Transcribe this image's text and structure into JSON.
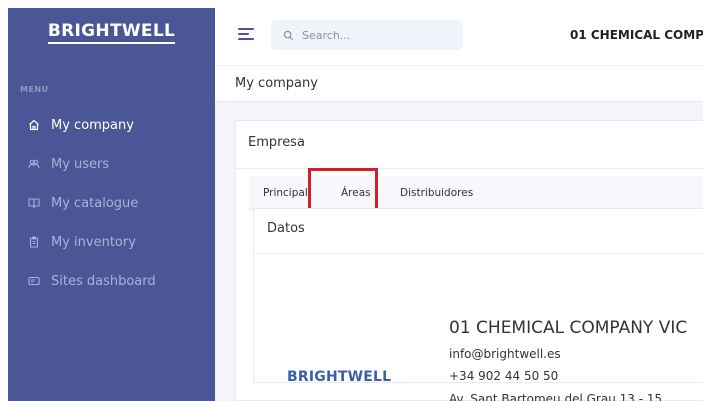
{
  "brand": {
    "logo_text": "BRIGHTWELL"
  },
  "sidebar": {
    "menu_title": "MENU",
    "items": [
      {
        "label": "My company",
        "icon": "home-icon",
        "active": true
      },
      {
        "label": "My users",
        "icon": "users-icon",
        "active": false
      },
      {
        "label": "My catalogue",
        "icon": "book-icon",
        "active": false
      },
      {
        "label": "My inventory",
        "icon": "clipboard-icon",
        "active": false
      },
      {
        "label": "Sites dashboard",
        "icon": "card-icon",
        "active": false
      }
    ]
  },
  "topbar": {
    "search_placeholder": "Search...",
    "company_name": "01 CHEMICAL COMP"
  },
  "page": {
    "title": "My company"
  },
  "card": {
    "title": "Empresa",
    "tabs": [
      {
        "label": "Principal"
      },
      {
        "label": "Áreas"
      },
      {
        "label": "Distribuidores"
      }
    ]
  },
  "datos": {
    "title": "Datos",
    "logo_text": "BRIGHTWELL",
    "company_name": "01 CHEMICAL COMPANY VIC",
    "email": "info@brightwell.es",
    "phone": "+34 902 44 50 50",
    "address": "Av. Sant Bartomeu del Grau 13 - 15"
  },
  "colors": {
    "sidebar_bg": "#4a5695",
    "highlight": "#d31f26",
    "logo_blue": "#3a60a8"
  }
}
